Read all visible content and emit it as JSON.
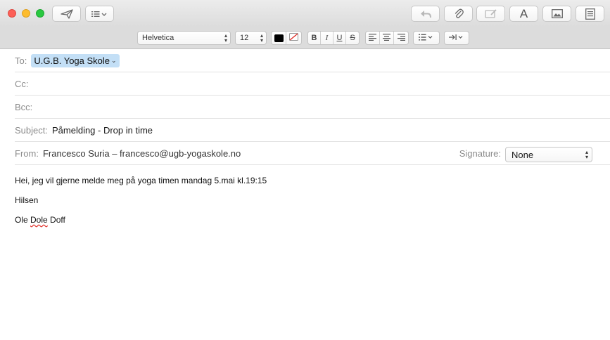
{
  "toolbar": {
    "buttons": [
      "send-icon",
      "header-fields-icon",
      "reply-icon",
      "attach-icon",
      "markup-icon",
      "fonts-icon",
      "photo-browser-icon",
      "stationery-icon"
    ],
    "fonts_label": "A"
  },
  "format_bar": {
    "font_family": "Helvetica",
    "font_size": "12",
    "text_color": "#000000",
    "bold": "B",
    "italic": "I",
    "underline": "U",
    "strikethrough": "S"
  },
  "header": {
    "to_label": "To:",
    "to_recipient": "U.G.B. Yoga Skole",
    "cc_label": "Cc:",
    "bcc_label": "Bcc:",
    "subject_label": "Subject:",
    "subject_value": "Påmelding - Drop in time",
    "from_label": "From:",
    "from_value": "Francesco Suria – francesco@ugb-yogaskole.no",
    "signature_label": "Signature:",
    "signature_value": "None"
  },
  "message": {
    "line1": "Hei, jeg vil gjerne melde meg på yoga timen mandag 5.mai kl.19:15",
    "line2": "Hilsen",
    "line3_a": "Ole ",
    "line3_b": "Dole",
    "line3_c": " Doff"
  }
}
